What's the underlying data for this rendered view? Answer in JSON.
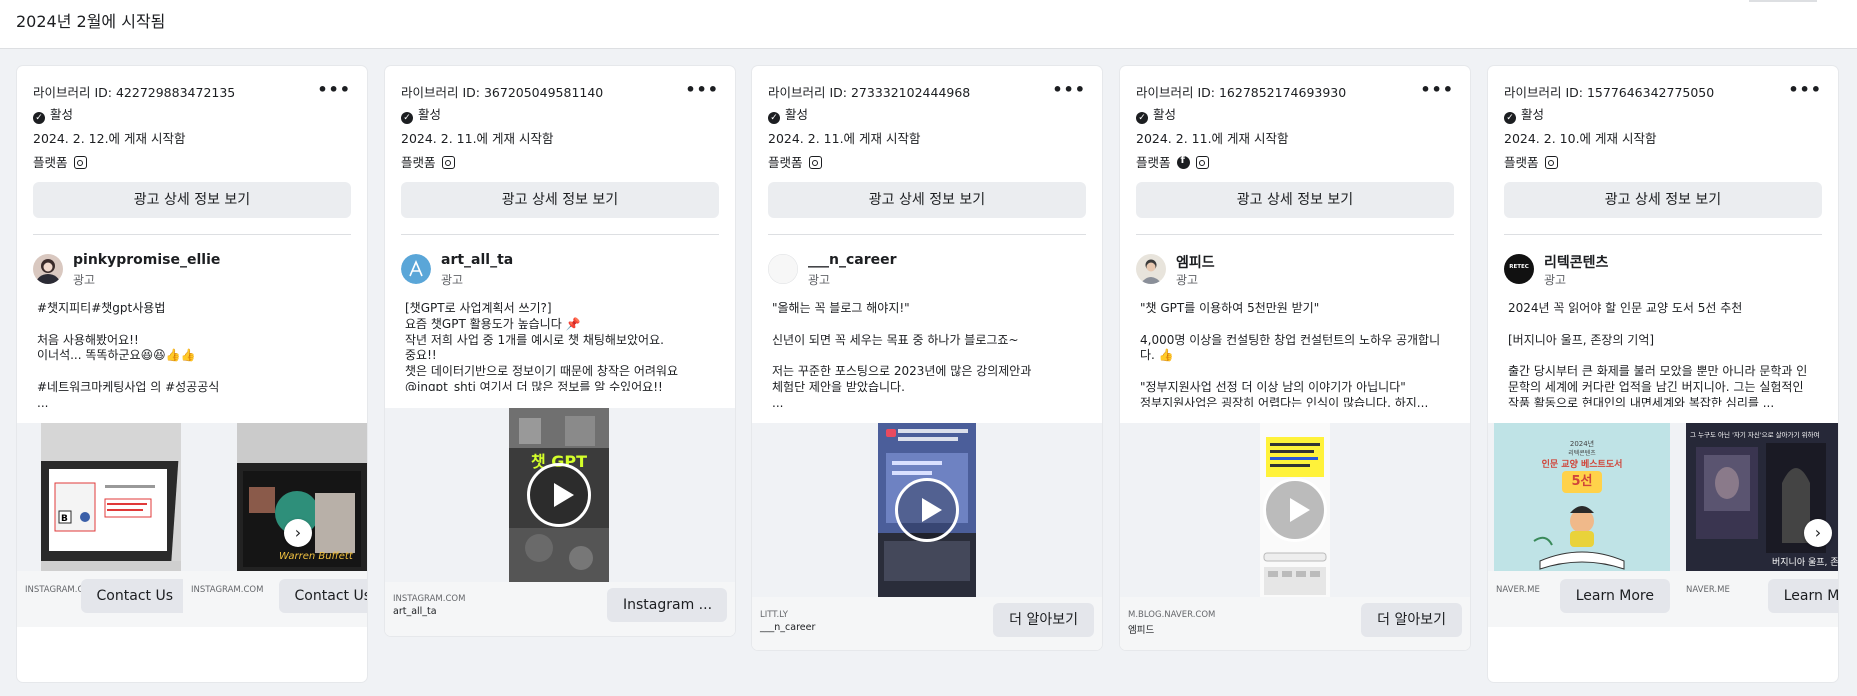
{
  "header": {
    "title": "2024년 2월에 시작됨"
  },
  "common": {
    "active": "활성",
    "platform_label": "플랫폼",
    "detail_button": "광고 상세 정보 보기",
    "ad_label": "광고",
    "more": "•••"
  },
  "cards": [
    {
      "library_id": "라이브러리 ID: 422729883472135",
      "started": "2024. 2. 12.에 게재 시작함",
      "advertiser": "pinkypromise_ellie",
      "body": "#챗지피티#챗gpt사용법\n\n처음 사용해봤어요!!\n이너석... 똑똑하군요😆😆👍👍\n\n#네트워크마케팅사업 의 #성공공식\n...",
      "carousel": [
        {
          "domain": "INSTAGRAM.COM",
          "cta": "Contact Us"
        },
        {
          "domain": "INSTAGRAM.COM",
          "cta": "Contact Us"
        }
      ]
    },
    {
      "library_id": "라이브러리 ID: 367205049581140",
      "started": "2024. 2. 11.에 게재 시작함",
      "advertiser": "art_all_ta",
      "body": "[챗GPT로 사업계획서 쓰기?]\n요즘 챗GPT 활용도가 높습니다 📌\n작년 저희 사업 중 1개를 예시로 챗 채팅해보았어요.\n중요!!\n챗은 데이터기반으로 정보이기 때문에 창작은 어려워요\n@ingpt_shtj 여기서 더 많은 정보를 알 수있어요!!",
      "video_text": "챗 GPT",
      "domain": "INSTAGRAM.COM",
      "sub": "art_all_ta",
      "cta": "Instagram ..."
    },
    {
      "library_id": "라이브러리 ID: 273332102444968",
      "started": "2024. 2. 11.에 게재 시작함",
      "advertiser": "___n_career",
      "body": "\"올해는 꼭 블로그 해야지!\"\n\n신년이 되면 꼭 세우는 목표 중 하나가 블로그죠~\n\n저는 꾸준한 포스팅으로 2023년에 많은 강의제안과\n체험단 제안을 받았습니다.\n...",
      "domain": "LITT.LY",
      "sub": "___n_career",
      "cta": "더 알아보기"
    },
    {
      "library_id": "라이브러리 ID: 1627852174693930",
      "started": "2024. 2. 11.에 게재 시작함",
      "advertiser": "엠피드",
      "body": "\"챗 GPT를 이용하여 5천만원 받기\"\n\n4,000명 이상을 컨설팅한 창업 컨설턴트의 노하우 공개합니다. 👍\n\n\"정부지원사업 선정 더 이상 남의 이야기가 아닙니다\"\n정부지원사업은 굉장히 어렵다는 인식이 많습니다. 하지...",
      "domain": "M.BLOG.NAVER.COM",
      "sub": "엠피드",
      "cta": "더 알아보기"
    },
    {
      "library_id": "라이브러리 ID: 1577646342775050",
      "started": "2024. 2. 10.에 게재 시작함",
      "advertiser": "리텍콘텐츠",
      "avatar_text": "RETEC",
      "body": "2024년 꼭 읽어야 할 인문 교양 도서 5선 추천\n\n[버지니아 울프, 존장의 기억]\n\n출간 당시부터 큰 화제를 불러 모았을 뿐만 아니라 문학과 인문학의 세계에 커다란 업적을 남긴 버지니아. 그는 실험적인 작품 활동으로 현대인의 내면세계와 복잡한 심리를 ...",
      "book_year": "2024년",
      "book_sub": "리텍콘텐츠",
      "book_title": "인문 교양 베스트도서",
      "book_count": "5선",
      "book2_caption": "그 누구도 아닌 '자기 자신'으로 살아가기 위하여",
      "book2_title": "버지니아 울프, 존장의",
      "carousel": [
        {
          "domain": "NAVER.ME",
          "cta": "Learn More"
        },
        {
          "domain": "NAVER.ME",
          "cta": "Learn More"
        }
      ]
    }
  ]
}
